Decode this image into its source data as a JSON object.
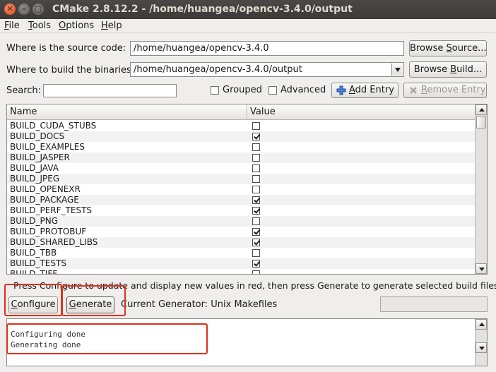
{
  "window": {
    "title": "CMake 2.8.12.2 - /home/huangea/opencv-3.4.0/output",
    "close_glyph": "✕",
    "min_glyph": "–",
    "max_glyph": "□"
  },
  "menu": {
    "file_u": "F",
    "file_rest": "ile",
    "tools_u": "T",
    "tools_rest": "ools",
    "options_u": "O",
    "options_rest": "ptions",
    "help_u": "H",
    "help_rest": "elp"
  },
  "source": {
    "label": "Where is the source code:",
    "value": "/home/huangea/opencv-3.4.0",
    "button_pre": "Browse ",
    "button_u": "S",
    "button_post": "ource..."
  },
  "build": {
    "label": "Where to build the binaries:",
    "value": "/home/huangea/opencv-3.4.0/output",
    "button_pre": "Browse ",
    "button_u": "B",
    "button_post": "uild..."
  },
  "search": {
    "label": "Search:",
    "value": ""
  },
  "toggles": {
    "grouped": "Grouped",
    "advanced": "Advanced",
    "grouped_checked": false,
    "advanced_checked": false
  },
  "entry_buttons": {
    "add_u": "A",
    "add_rest": "dd Entry",
    "remove_u": "R",
    "remove_rest": "emove Entry"
  },
  "table": {
    "headers": {
      "name": "Name",
      "value": "Value"
    },
    "rows": [
      {
        "name": "BUILD_CUDA_STUBS",
        "checked": false
      },
      {
        "name": "BUILD_DOCS",
        "checked": true
      },
      {
        "name": "BUILD_EXAMPLES",
        "checked": false
      },
      {
        "name": "BUILD_JASPER",
        "checked": false
      },
      {
        "name": "BUILD_JAVA",
        "checked": false
      },
      {
        "name": "BUILD_JPEG",
        "checked": false
      },
      {
        "name": "BUILD_OPENEXR",
        "checked": false
      },
      {
        "name": "BUILD_PACKAGE",
        "checked": true
      },
      {
        "name": "BUILD_PERF_TESTS",
        "checked": true
      },
      {
        "name": "BUILD_PNG",
        "checked": false
      },
      {
        "name": "BUILD_PROTOBUF",
        "checked": true
      },
      {
        "name": "BUILD_SHARED_LIBS",
        "checked": true
      },
      {
        "name": "BUILD_TBB",
        "checked": false
      },
      {
        "name": "BUILD_TESTS",
        "checked": true
      },
      {
        "name": "BUILD_TIFF",
        "checked": false
      }
    ]
  },
  "hint": "Press Configure to update and display new values in red, then press Generate to generate selected build files.",
  "actions": {
    "configure_u": "C",
    "configure_rest": "onfigure",
    "generate_u": "G",
    "generate_rest": "enerate",
    "generator_label": "Current Generator: Unix Makefiles"
  },
  "output": {
    "lines": [
      "Configuring done",
      "Generating done"
    ]
  },
  "colors": {
    "highlight": "#e0311b",
    "titlebar": "#3b3a36",
    "close_button": "#df4a16"
  }
}
